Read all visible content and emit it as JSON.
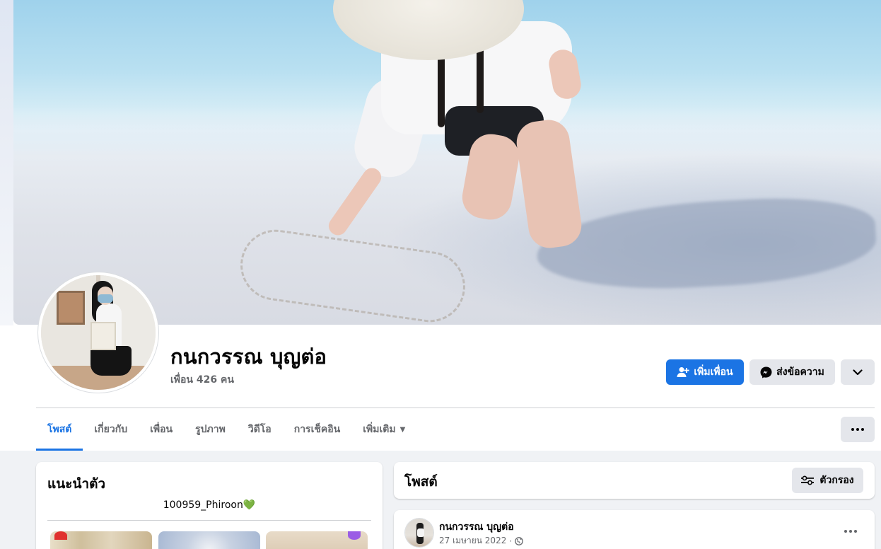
{
  "profile": {
    "name": "กนกวรรณ บุญต่อ",
    "friends_count": "เพื่อน 426 คน"
  },
  "actions": {
    "add_friend": "เพิ่มเพื่อน",
    "message": "ส่งข้อความ"
  },
  "tabs": [
    {
      "label": "โพสต์",
      "active": true
    },
    {
      "label": "เกี่ยวกับ",
      "active": false
    },
    {
      "label": "เพื่อน",
      "active": false
    },
    {
      "label": "รูปภาพ",
      "active": false
    },
    {
      "label": "วิดีโอ",
      "active": false
    },
    {
      "label": "การเช็คอิน",
      "active": false
    },
    {
      "label": "เพิ่มเติม",
      "active": false
    }
  ],
  "intro": {
    "title": "แนะนำตัว",
    "bio": "100959_Phiroon",
    "bio_emoji": "💚"
  },
  "posts_section": {
    "title": "โพสต์",
    "filter_label": "ตัวกรอง"
  },
  "post": {
    "author": "กนกวรรณ บุญต่อ",
    "date": "27 เมษายน 2022",
    "separator": "·",
    "privacy_icon": "globe-icon"
  },
  "colors": {
    "accent": "#1b74e4",
    "secondary_button": "#e4e6eb",
    "muted_text": "#65676b",
    "page_bg": "#f0f2f5"
  }
}
